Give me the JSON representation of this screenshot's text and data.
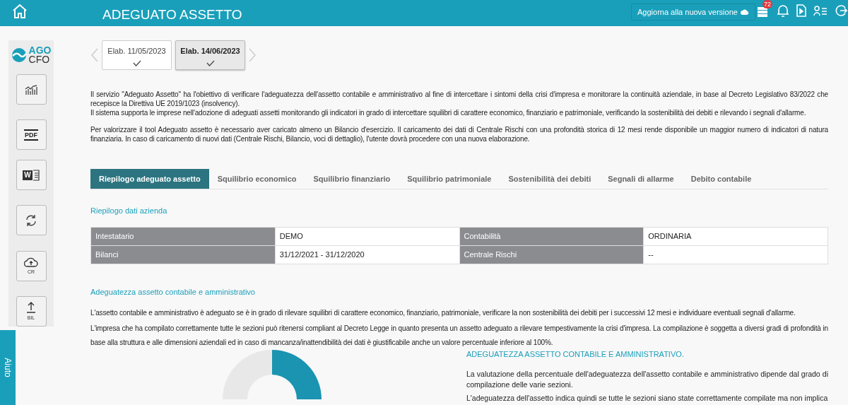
{
  "header": {
    "title": "ADEGUATO ASSETTO",
    "update_button": "Aggiorna alla nuova versione",
    "badge": "72"
  },
  "sidebar": {
    "logo": {
      "line1": "AGO",
      "line2": "CFO"
    },
    "buttons": [
      {
        "kind": "chart"
      },
      {
        "kind": "pdf",
        "label": "PDF"
      },
      {
        "kind": "word",
        "label": "W"
      },
      {
        "kind": "refresh"
      },
      {
        "kind": "cloud",
        "label": "CR"
      },
      {
        "kind": "upload",
        "label": "BIL"
      }
    ]
  },
  "help_tab": "Aiuto",
  "elaborations": [
    {
      "label": "Elab. 11/05/2023",
      "selected": false
    },
    {
      "label": "Elab. 14/06/2023",
      "selected": true
    }
  ],
  "intro": [
    [
      "Il servizio \"Adeguato Assetto\" ha l'obiettivo di verificare l'adeguatezza dell'assetto contabile e amministrativo al fine di intercettare i sintomi della crisi d'impresa e monitorare la continuità aziendale, in base al Decreto Legislativo 83/2022 che recepisce la Direttiva UE 2019/1023 (insolvency).",
      "Il sistema supporta le imprese nell'adozione di adeguati assetti monitorando gli indicatori in grado di intercettare squilibri di carattere economico, finanziario e patrimoniale, verificando la sostenibilità dei debiti e rilevando i segnali d'allarme."
    ],
    [
      "Per valorizzare il tool Adeguato assetto è necessario aver caricato almeno un Bilancio d'esercizio. Il caricamento dei dati di Centrale Rischi con una profondità storica di 12 mesi rende disponibile un maggior numero di indicatori di natura finanziaria. In caso di caricamento di nuovi dati (Centrale Rischi, Bilancio, voci di dettaglio), l'utente dovrà procedere con una nuova elaborazione."
    ]
  ],
  "tabs": [
    {
      "label": "Riepilogo adeguato assetto",
      "selected": true
    },
    {
      "label": "Squilibrio economico",
      "selected": false
    },
    {
      "label": "Squilibrio finanziario",
      "selected": false
    },
    {
      "label": "Squilibrio patrimoniale",
      "selected": false
    },
    {
      "label": "Sostenibilità dei debiti",
      "selected": false
    },
    {
      "label": "Segnali di allarme",
      "selected": false
    },
    {
      "label": "Debito contabile",
      "selected": false
    }
  ],
  "company": {
    "title": "Riepilogo dati azienda",
    "rows": [
      [
        {
          "kind": "label",
          "text": "Intestatario"
        },
        {
          "kind": "value",
          "text": "DEMO"
        },
        {
          "kind": "label",
          "text": "Contabilità"
        },
        {
          "kind": "value",
          "text": "ORDINARIA"
        }
      ],
      [
        {
          "kind": "label",
          "text": "Bilanci"
        },
        {
          "kind": "value",
          "text": "31/12/2021 - 31/12/2020"
        },
        {
          "kind": "label",
          "text": "Centrale Rischi"
        },
        {
          "kind": "value",
          "text": "--"
        }
      ]
    ]
  },
  "adequacy": {
    "title": "Adeguatezza assetto contabile e amministrativo",
    "paragraphs": [
      "L'assetto contabile e amministrativo è adeguato se è in grado di rilevare squilibri di carattere economico, finanziario, patrimoniale, verificare la non sostenibilità dei debiti per i successivi 12 mesi e individuare eventuali segnali d'allarme.",
      "L'impresa che ha compilato correttamente tutte le sezioni può ritenersi compliant al Decreto Legge in quanto presenta un assetto adeguato a rilevare tempestivamente la crisi d'impresa. La compilazione è soggetta a diversi gradi di profondità in base alla struttura e alle dimensioni aziendali ed in caso di mancanza/inattendibilità dei dati è giustificabile anche un valore percentuale inferiore al 100%."
    ],
    "detail": {
      "title": "ADEGUATEZZA ASSETTO CONTABILE E AMMINISTRATIVO.",
      "paragraphs": [
        "La valutazione della percentuale dell'adeguatezza dell'assetto contabile e amministrativo dipende dal grado di compilazione delle varie sezioni.",
        "L'adeguatezza dell'assetto indica quindi se tutte le sezioni siano state correttamente compilate ma non implica"
      ]
    }
  }
}
